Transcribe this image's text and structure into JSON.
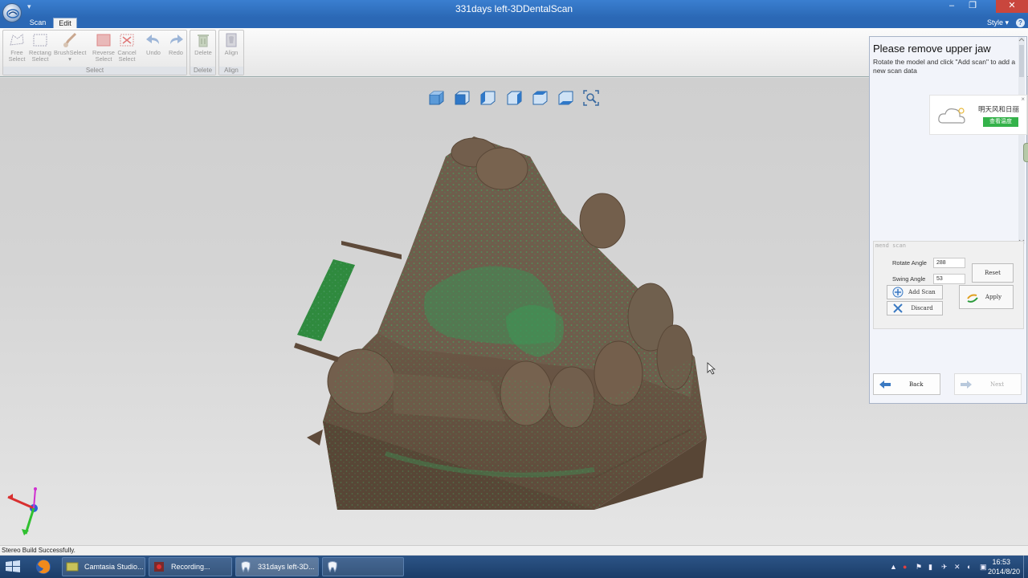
{
  "window": {
    "title": "331days left-3DDentalScan",
    "minimize_glyph": "–",
    "restore_glyph": "❐",
    "close_glyph": "✕",
    "quick_access_glyph": "▾"
  },
  "tabs": [
    {
      "label": "Scan",
      "active": false
    },
    {
      "label": "Edit",
      "active": true
    }
  ],
  "style_menu": {
    "label": "Style",
    "glyph": "▾",
    "help_glyph": "?"
  },
  "ribbon": {
    "groups": [
      {
        "label": "Select",
        "buttons": [
          {
            "line1": "Free",
            "line2": "Select",
            "icon": "free-select-icon"
          },
          {
            "line1": "Rectang",
            "line2": "Select",
            "icon": "rectangle-select-icon"
          },
          {
            "line1": "BrushSelect",
            "line2": "▾",
            "icon": "brush-select-icon"
          },
          {
            "line1": "Reverse",
            "line2": "Select",
            "icon": "reverse-select-icon"
          },
          {
            "line1": "Cancel",
            "line2": "Select",
            "icon": "cancel-select-icon"
          },
          {
            "line1": "Undo",
            "line2": "",
            "icon": "undo-icon"
          },
          {
            "line1": "Redo",
            "line2": "",
            "icon": "redo-icon"
          }
        ]
      },
      {
        "label": "Delete",
        "buttons": [
          {
            "line1": "Delete",
            "line2": "",
            "icon": "trash-icon"
          }
        ]
      },
      {
        "label": "Align",
        "buttons": [
          {
            "line1": "Align",
            "line2": "",
            "icon": "align-icon"
          }
        ]
      }
    ]
  },
  "view_buttons": [
    "view-iso-icon",
    "view-front-icon",
    "view-left-icon",
    "view-right-icon",
    "view-top-icon",
    "view-bottom-icon",
    "zoom-fit-icon"
  ],
  "panel": {
    "title": "Please remove upper jaw",
    "description": "Rotate the model and click \"Add scan\" to add a new scan data",
    "weather_widget": {
      "text": "明天风和日丽",
      "button": "查看温度",
      "close": "×"
    },
    "scan_box_title": "mend scan",
    "rotate_angle_label": "Rotate Angle",
    "rotate_angle_value": "288",
    "swing_angle_label": "Swing Angle",
    "swing_angle_value": "53",
    "reset_label": "Reset",
    "add_scan_label": "Add Scan",
    "discard_label": "Discard",
    "apply_label": "Apply",
    "back_label": "Back",
    "next_label": "Next"
  },
  "status": {
    "text": "Stereo Build Successfully."
  },
  "taskbar": {
    "tasks": [
      {
        "label": "Camtasia Studio...",
        "icon": "camtasia-icon"
      },
      {
        "label": "Recording...",
        "icon": "recording-icon"
      },
      {
        "label": "331days left-3D...",
        "icon": "tooth-app-icon"
      },
      {
        "label": "",
        "icon": "tooth-app-icon"
      }
    ],
    "clock_time": "16:53",
    "clock_date": "2014/8/20",
    "tray_glyphs": [
      "▲",
      "●",
      "⚑",
      "▮",
      "✈",
      "✕",
      "◐",
      "▣"
    ]
  },
  "colors": {
    "title_bar": "#2b68b5",
    "model_brown": "#6e5a48",
    "scan_green": "#3e8e55",
    "weather_button": "#34b24a"
  }
}
